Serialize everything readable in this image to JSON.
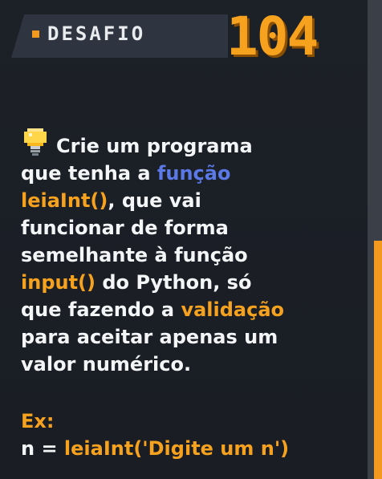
{
  "header": {
    "label": "DESAFIO",
    "number": "104"
  },
  "description": {
    "line1": "Crie um programa",
    "line2_a": "que tenha a ",
    "line2_b": "função",
    "line3_a": "leiaInt()",
    "line3_b": ", que vai",
    "line4": "funcionar de forma",
    "line5": "semelhante à função",
    "line6_a": "input()",
    "line6_b": " do Python, só",
    "line7_a": "que fazendo a ",
    "line7_b": "validação",
    "line8": "para aceitar apenas um",
    "line9": "valor numérico."
  },
  "example": {
    "label": "Ex:",
    "code_a": "n = ",
    "code_b": "leiaInt('Digite um n')"
  },
  "colors": {
    "background": "#1a1e25",
    "accent_orange": "#f6a21e",
    "accent_blue": "#5a78e6",
    "text": "#f4f5f7"
  },
  "icons": {
    "tip": "lightbulb-icon"
  }
}
